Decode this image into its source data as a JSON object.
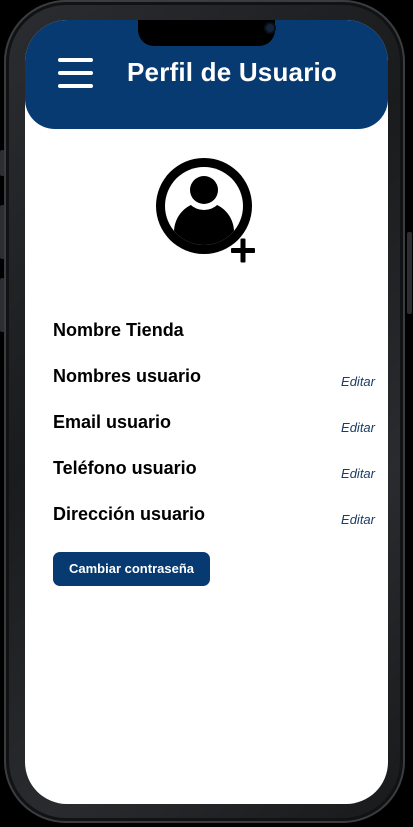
{
  "header": {
    "title": "Perfil de Usuario",
    "menu_icon": "hamburger-menu-icon",
    "background_color": "#063a70"
  },
  "avatar": {
    "icon": "user-add-icon"
  },
  "profile_fields": [
    {
      "label": "Nombre Tienda",
      "edit_label": ""
    },
    {
      "label": "Nombres usuario",
      "edit_label": "Editar"
    },
    {
      "label": "Email usuario",
      "edit_label": "Editar"
    },
    {
      "label": "Teléfono usuario",
      "edit_label": "Editar"
    },
    {
      "label": "Dirección usuario",
      "edit_label": "Editar"
    }
  ],
  "change_password": {
    "label": "Cambiar contraseña"
  },
  "colors": {
    "primary": "#063a70",
    "edit_link": "#1b3c66"
  }
}
